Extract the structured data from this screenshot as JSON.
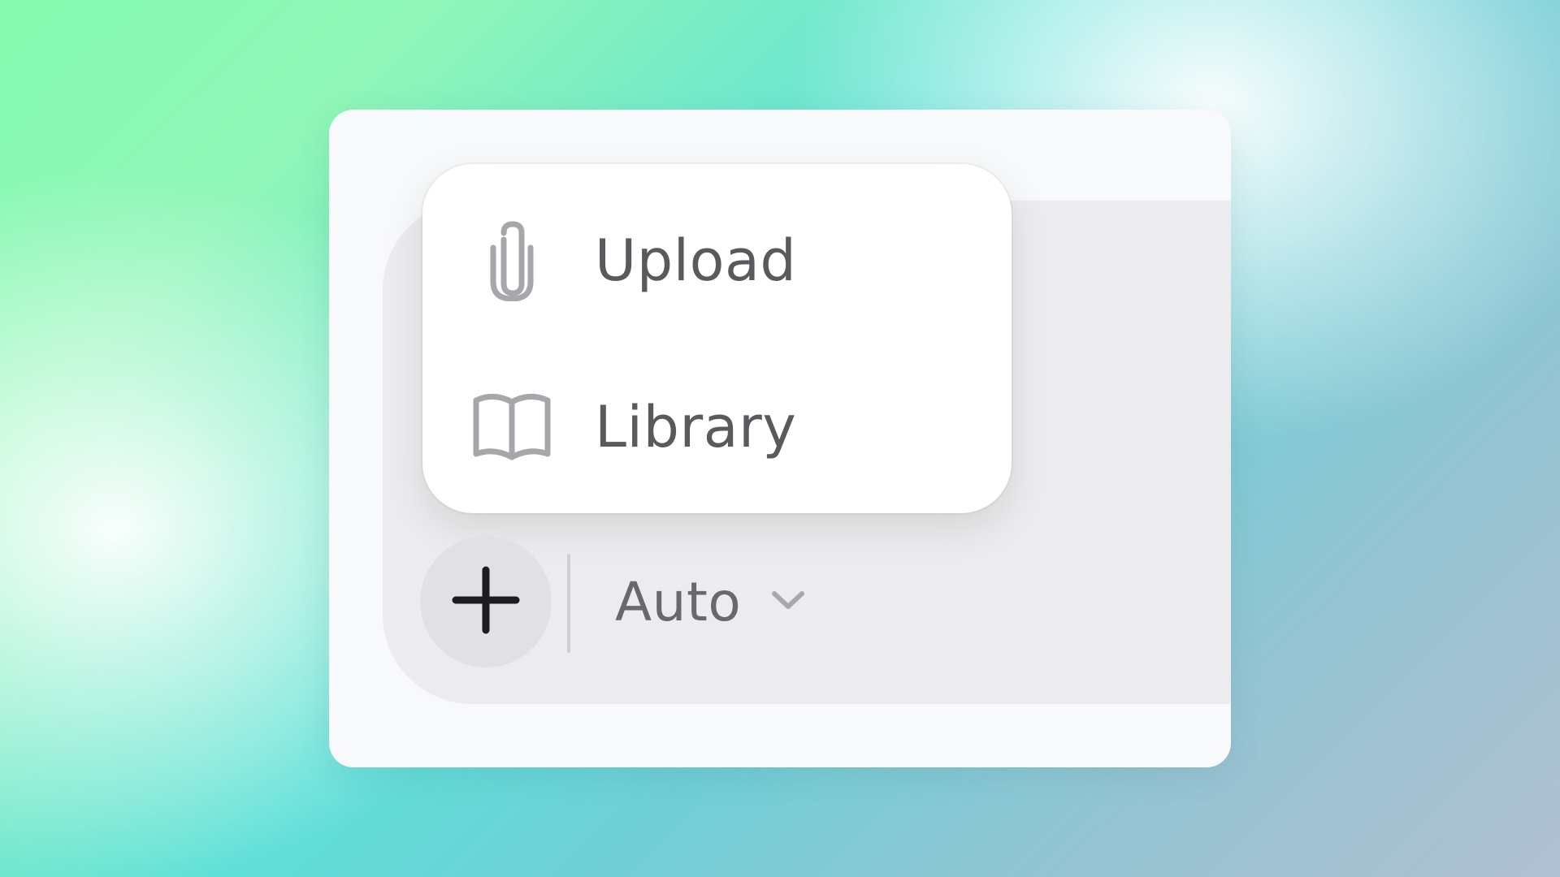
{
  "menu": {
    "items": [
      {
        "label": "Upload",
        "icon": "paperclip-icon"
      },
      {
        "label": "Library",
        "icon": "book-icon"
      }
    ]
  },
  "toolbar": {
    "add_icon": "plus-icon",
    "model": {
      "label": "Auto",
      "icon": "chevron-down-icon"
    }
  },
  "colors": {
    "panel": "#f8f9fb",
    "composer": "#ececee",
    "plus_button": "#e1e1e4",
    "text": "#5a5a5e",
    "icon": "#a5a5aa"
  }
}
